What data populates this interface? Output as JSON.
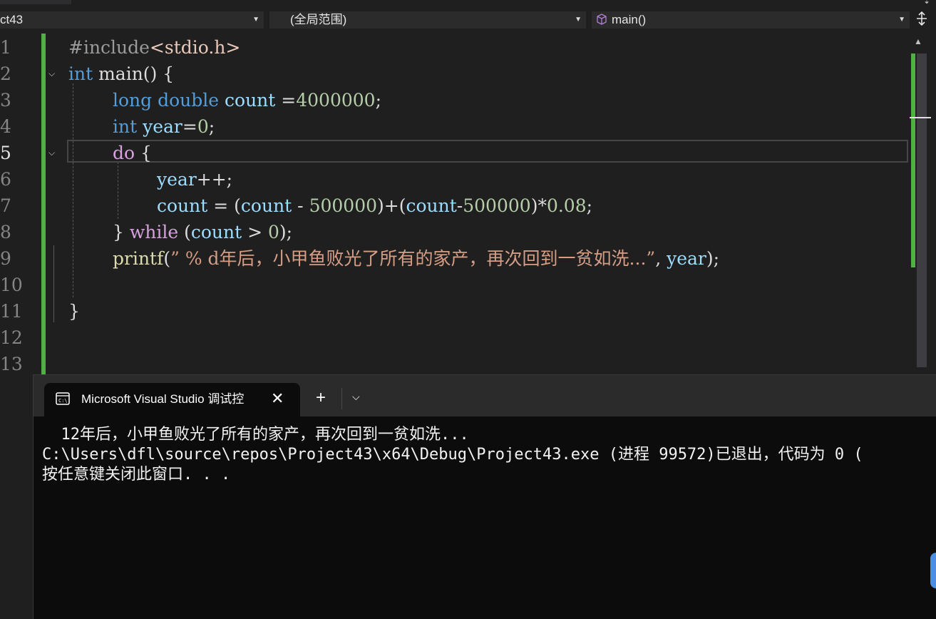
{
  "navbar": {
    "project": "ct43",
    "scope": "(全局范围)",
    "member": "main()"
  },
  "editor": {
    "line_numbers": [
      "1",
      "2",
      "3",
      "4",
      "5",
      "6",
      "7",
      "8",
      "9",
      "10",
      "11",
      "12",
      "13"
    ],
    "current_line": "5"
  },
  "code": {
    "l1": {
      "a": "#include",
      "b": "<stdio.h>"
    },
    "l2": {
      "a": "int",
      "b": " main() {"
    },
    "l3": {
      "a": "long double",
      "b": "count",
      "c": " =",
      "d": "4000000",
      "e": ";"
    },
    "l4": {
      "a": "int",
      "b": "year",
      "c": "=",
      "d": "0",
      "e": ";"
    },
    "l5": {
      "a": "do",
      "b": " {"
    },
    "l6": {
      "a": "year",
      "b": "++;"
    },
    "l7": {
      "a": "count",
      "b": " = (",
      "c": "count",
      "d": " - ",
      "e": "500000",
      "f": ")+(",
      "g": "count",
      "h": "-",
      "i": "500000",
      "j": ")*",
      "k": "0.08",
      "l": ";"
    },
    "l8": {
      "a": "} ",
      "b": "while",
      "c": " (",
      "d": "count",
      "e": " > ",
      "f": "0",
      "g": ");"
    },
    "l9": {
      "a": "printf",
      "b": "(",
      "c": "” % d年后，小甲鱼败光了所有的家产，再次回到一贫如洗...”",
      "d": ", ",
      "e": "year",
      "f": ");"
    },
    "l11": {
      "a": "}"
    }
  },
  "console": {
    "tab_title": "Microsoft Visual Studio 调试控",
    "close_glyph": "✕",
    "new_tab_glyph": "+",
    "dropdown_glyph": "⌵",
    "output": [
      "  12年后，小甲鱼败光了所有的家产，再次回到一贫如洗...",
      "C:\\Users\\dfl\\source\\repos\\Project43\\x64\\Debug\\Project43.exe (进程 99572)已退出，代码为 0 (",
      "按任意键关闭此窗口. . ."
    ]
  },
  "icons": {
    "member_icon": "cube-icon",
    "split_icon": "split-icon",
    "terminal_icon": "terminal-icon"
  },
  "colors": {
    "keyword": "#569cd6",
    "control": "#d8a0df",
    "variable": "#9cdcfe",
    "number": "#b5cea8",
    "string": "#d69d85",
    "function": "#dcdcaa",
    "change_bar": "#4eb240",
    "console_bg": "#0c0c0c"
  }
}
